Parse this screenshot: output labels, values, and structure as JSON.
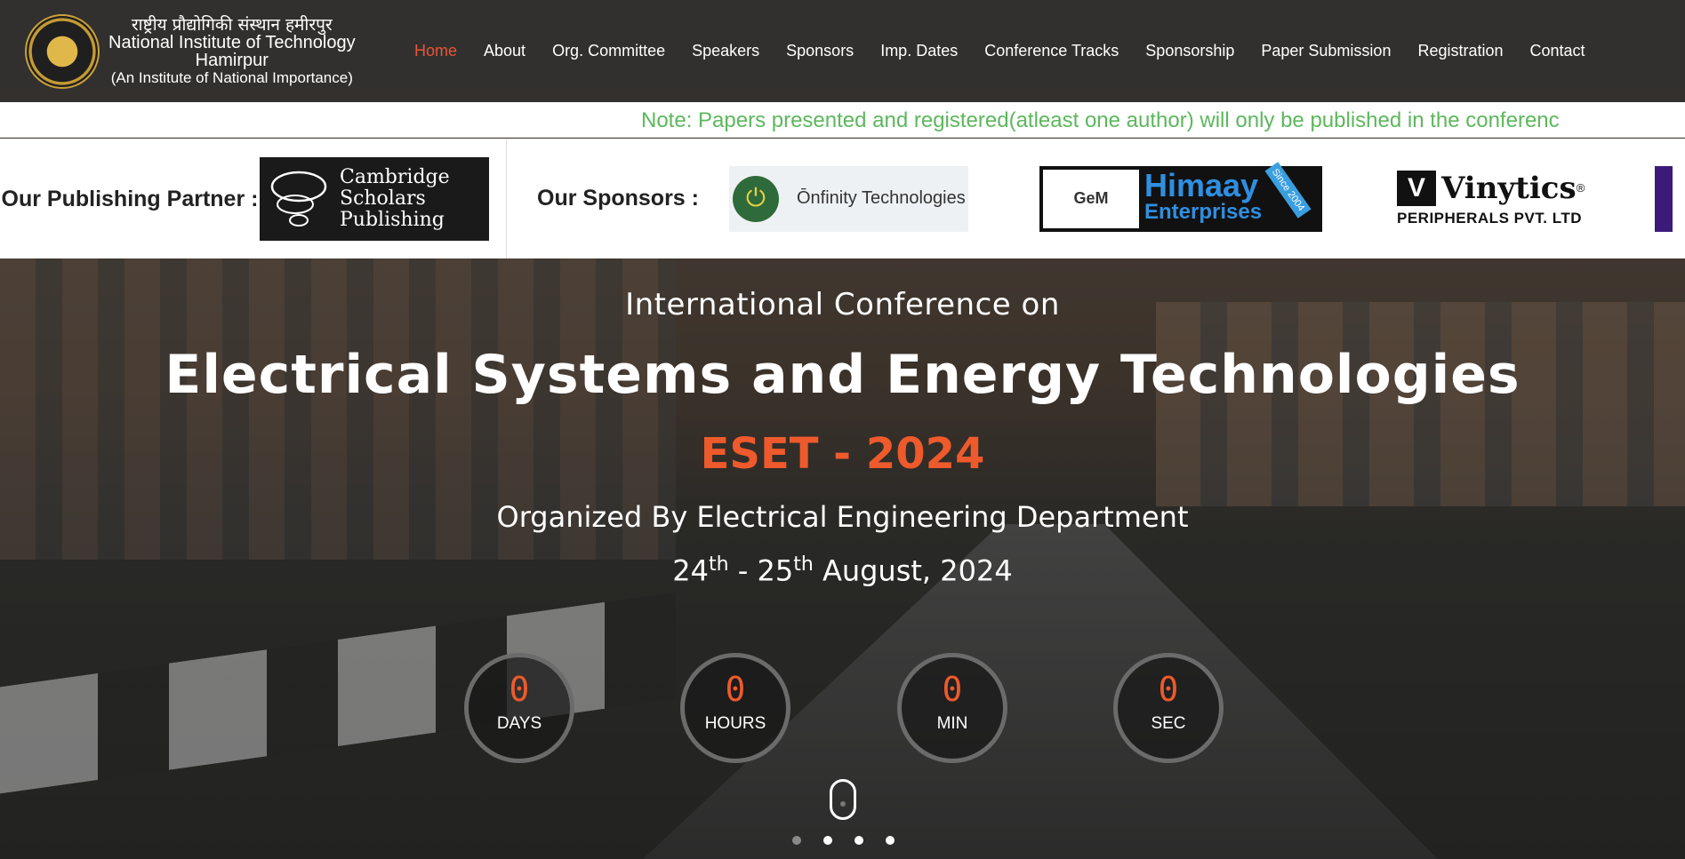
{
  "header": {
    "institute_hindi": "राष्ट्रीय प्रौद्योगिकी संस्थान हमीरपुर",
    "institute_name_line1": "National Institute of Technology",
    "institute_name_line2": "Hamirpur",
    "institute_tagline": "(An Institute of National Importance)",
    "logo_icon": "institute-seal"
  },
  "nav": {
    "items": [
      {
        "label": "Home",
        "active": true
      },
      {
        "label": "About"
      },
      {
        "label": "Org. Committee"
      },
      {
        "label": "Speakers"
      },
      {
        "label": "Sponsors"
      },
      {
        "label": "Imp. Dates"
      },
      {
        "label": "Conference Tracks"
      },
      {
        "label": "Sponsorship"
      },
      {
        "label": "Paper Submission"
      },
      {
        "label": "Registration"
      },
      {
        "label": "Contact"
      }
    ],
    "active_color": "#e8553a"
  },
  "ticker": {
    "text": "Note: Papers presented and registered(atleast one author) will only be published in the conferenc",
    "color": "#5cb85c"
  },
  "partner": {
    "label": "Our Publishing Partner :",
    "logo_lines": [
      "Cambridge",
      "Scholars",
      "Publishing"
    ]
  },
  "sponsors": {
    "label": "Our Sponsors :",
    "onfinity": {
      "name": "Ōnfinity Technologies"
    },
    "himaay": {
      "gem": "GeM",
      "name_line1": "Himaay",
      "name_line2": "Enterprises",
      "since": "Since 2004"
    },
    "vinytics": {
      "logo_letter": "V",
      "name": "Vinytics",
      "mark": "®",
      "sub": "PERIPHERALS PVT. LTD"
    }
  },
  "hero": {
    "intro": "International Conference on",
    "title": "Electrical Systems and Energy Technologies",
    "acronym": "ESET - 2024",
    "organizer": "Organized By Electrical Engineering Department",
    "date_day1": "24",
    "date_sup1": "th",
    "date_sep": " - ",
    "date_day2": "25",
    "date_sup2": "th",
    "date_rest": " August, 2024",
    "accent_color": "#ee5a2c"
  },
  "countdown": [
    {
      "value": "0",
      "label": "DAYS"
    },
    {
      "value": "0",
      "label": "HOURS"
    },
    {
      "value": "0",
      "label": "MIN"
    },
    {
      "value": "0",
      "label": "SEC"
    }
  ],
  "slider": {
    "slide_count": 4,
    "active_index": 0
  }
}
